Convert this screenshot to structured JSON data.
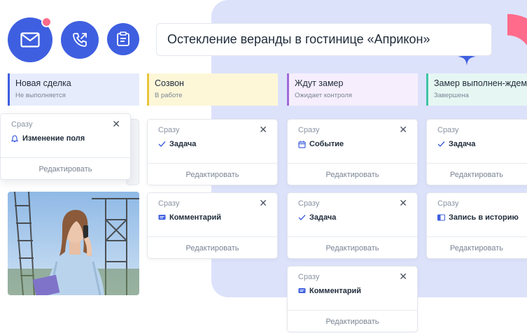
{
  "deal_title": "Остекление веранды в гостинице «Априкон»",
  "edit_label": "Редактировать",
  "stages": [
    {
      "name": "Новая сделка",
      "status": "Не выполняется"
    },
    {
      "name": "Созвон",
      "status": "В работе"
    },
    {
      "name": "Ждут замер",
      "status": "Ожидает контроля"
    },
    {
      "name": "Замер выполнен-ждем",
      "status": "Завершена"
    }
  ],
  "cards": [
    {
      "timing": "Сразу",
      "action": "Изменение поля",
      "icon": "bell-icon"
    },
    {
      "timing": "Сразу",
      "action": "Задача",
      "icon": "check-icon"
    },
    {
      "timing": "Сразу",
      "action": "Событие",
      "icon": "calendar-icon"
    },
    {
      "timing": "Сразу",
      "action": "Задача",
      "icon": "check-icon"
    },
    {
      "timing": "Сразу",
      "action": "Комментарий",
      "icon": "comment-icon"
    },
    {
      "timing": "Сразу",
      "action": "Задача",
      "icon": "check-icon"
    },
    {
      "timing": "Сразу",
      "action": "Запись в историю",
      "icon": "history-icon"
    },
    {
      "timing": "Сразу",
      "action": "Комментарий",
      "icon": "comment-icon"
    }
  ],
  "colors": {
    "accent": "#3e5fe0",
    "panel": "#dde2fb",
    "pink": "#ff6b8a"
  }
}
